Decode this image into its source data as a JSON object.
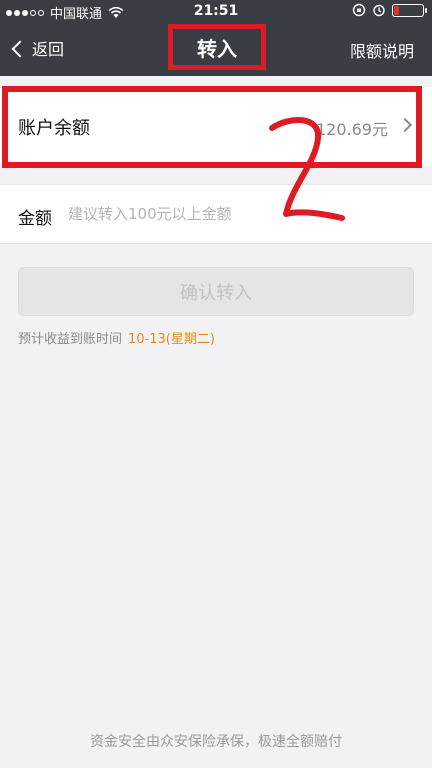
{
  "status_bar": {
    "carrier": "中国联通",
    "time": "21:51"
  },
  "nav": {
    "back_label": "返回",
    "title": "转入",
    "right_label": "限额说明"
  },
  "balance": {
    "label": "账户余额",
    "value": "120.69元"
  },
  "amount": {
    "label": "金额",
    "placeholder": "建议转入100元以上金额"
  },
  "confirm": {
    "label": "确认转入"
  },
  "expected": {
    "label": "预计收益到账时间",
    "date": "10-13(星期二)"
  },
  "footer": {
    "text": "资金安全由众安保险承保，极速全额赔付"
  },
  "annotation": {
    "handwritten": "2"
  },
  "colors": {
    "nav_bg": "#3b3d45",
    "highlight_red": "#e01a22",
    "date_orange": "#e8891f"
  }
}
